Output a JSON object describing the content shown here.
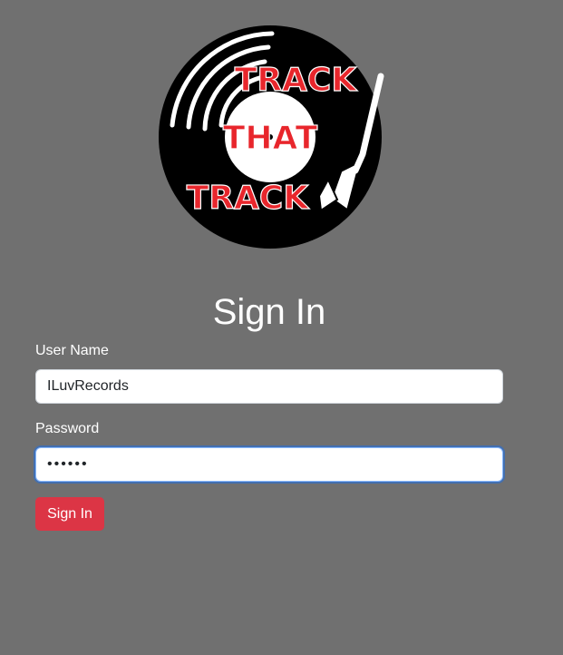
{
  "logo": {
    "word1": "TRACK",
    "word2": "THAT",
    "word3": "TRACK"
  },
  "form": {
    "title": "Sign In",
    "username_label": "User Name",
    "username_value": "ILuvRecords",
    "password_label": "Password",
    "password_value": "••••••",
    "submit_label": "Sign In"
  },
  "colors": {
    "background": "#707070",
    "accent_red": "#dc3545",
    "logo_red": "#e8262c",
    "focus_ring": "#86b7fe"
  }
}
